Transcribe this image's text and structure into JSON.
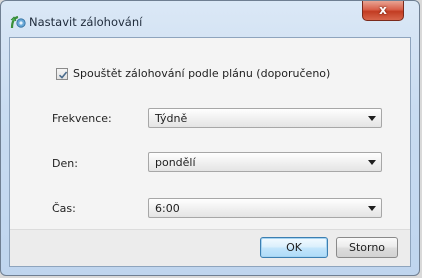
{
  "window": {
    "title": "Nastavit zálohování",
    "close_symbol": "x"
  },
  "schedule": {
    "checkbox_label": "Spouštět zálohování podle plánu (doporučeno)",
    "checked": true
  },
  "fields": {
    "frequency": {
      "label": "Frekvence:",
      "value": "Týdně"
    },
    "day": {
      "label": "Den:",
      "value": "pondělí"
    },
    "time": {
      "label": "Čas:",
      "value": "6:00"
    }
  },
  "buttons": {
    "ok": "OK",
    "cancel": "Storno"
  },
  "icons": {
    "app": "backup-icon",
    "check": "checkmark-icon",
    "dropdown": "chevron-down-icon"
  }
}
